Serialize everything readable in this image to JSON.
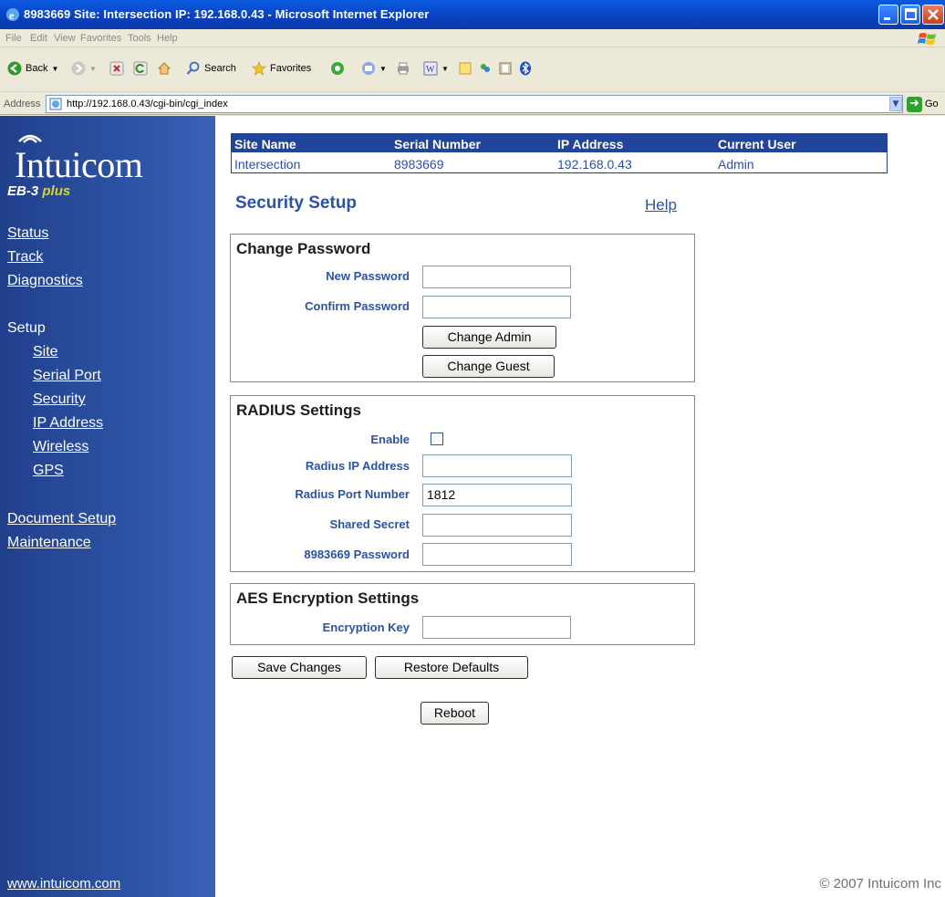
{
  "window": {
    "title": "8983669 Site: Intersection IP: 192.168.0.43 - Microsoft Internet Explorer"
  },
  "menu": [
    "File",
    "Edit",
    "View",
    "Favorites",
    "Tools",
    "Help"
  ],
  "toolbar": {
    "back_label": "Back",
    "search_label": "Search",
    "favorites_label": "Favorites"
  },
  "address": {
    "label": "Address",
    "url": "http://192.168.0.43/cgi-bin/cgi_index",
    "go_label": "Go"
  },
  "sidebar": {
    "logo": "Intuicom",
    "product": "EB-3",
    "product_suffix": "plus",
    "links": [
      "Status",
      "Track",
      "Diagnostics"
    ],
    "setup_label": "Setup",
    "setup_links": [
      "Site",
      "Serial Port",
      "Security",
      "IP Address",
      "Wireless",
      "GPS"
    ],
    "other_links": [
      "Document Setup",
      "Maintenance"
    ],
    "footer_link": "www.intuicom.com"
  },
  "info": {
    "headers": [
      "Site Name",
      "Serial Number",
      "IP Address",
      "Current User"
    ],
    "values": [
      "Intersection",
      "8983669",
      "192.168.0.43",
      "Admin"
    ]
  },
  "page": {
    "title": "Security Setup",
    "help": "Help"
  },
  "password": {
    "title": "Change Password",
    "new_label": "New Password",
    "confirm_label": "Confirm Password",
    "new_value": "",
    "confirm_value": "",
    "admin_button": "Change Admin",
    "guest_button": "Change Guest"
  },
  "radius": {
    "title": "RADIUS Settings",
    "enable_label": "Enable",
    "enabled": false,
    "ip_label": "Radius IP Address",
    "port_label": "Radius Port Number",
    "secret_label": "Shared Secret",
    "pw_label": "8983669 Password",
    "ip_value": "",
    "port_value": "1812",
    "secret_value": "",
    "pw_value": ""
  },
  "aes": {
    "title": "AES Encryption Settings",
    "key_label": "Encryption Key",
    "key_value": ""
  },
  "actions": {
    "save": "Save Changes",
    "restore": "Restore Defaults",
    "reboot": "Reboot"
  },
  "copyright": "© 2007 Intuicom Inc"
}
